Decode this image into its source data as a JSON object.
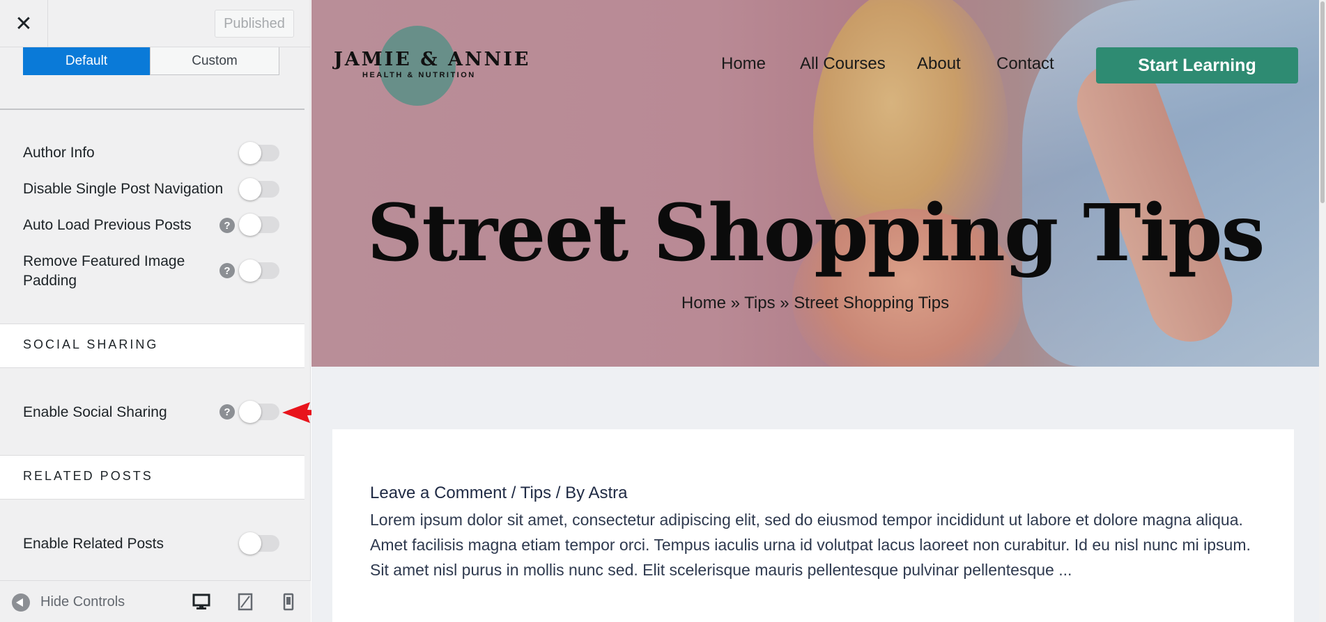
{
  "sidebar": {
    "published_label": "Published",
    "segments": {
      "default": "Default",
      "custom": "Custom"
    },
    "options": [
      {
        "label": "Author Info",
        "help": false,
        "enabled": false
      },
      {
        "label": "Disable Single Post Navigation",
        "help": false,
        "enabled": false
      },
      {
        "label": "Auto Load Previous Posts",
        "help": true,
        "enabled": false
      },
      {
        "label": "Remove Featured Image Padding",
        "label_line1": "Remove Featured Image",
        "label_line2": "Padding",
        "help": true,
        "enabled": false
      }
    ],
    "sections": [
      {
        "title": "SOCIAL SHARING",
        "options": [
          {
            "label": "Enable Social Sharing",
            "help": true,
            "enabled": false
          }
        ]
      },
      {
        "title": "RELATED POSTS",
        "options": [
          {
            "label": "Enable Related Posts",
            "help": false,
            "enabled": false
          }
        ]
      }
    ],
    "help_glyph": "?",
    "footer": {
      "hide_controls_label": "Hide Controls"
    }
  },
  "preview": {
    "logo": {
      "name": "JAMIE & ANNIE",
      "tagline": "HEALTH & NUTRITION"
    },
    "nav": [
      "Home",
      "All Courses",
      "About",
      "Contact"
    ],
    "cta_label": "Start Learning",
    "hero_title": "Street Shopping Tips",
    "breadcrumb": "Home » Tips » Street Shopping Tips",
    "post": {
      "meta": "Leave a Comment / Tips / By Astra",
      "excerpt": "Lorem ipsum dolor sit amet, consectetur adipiscing elit, sed do eiusmod tempor incididunt ut labore et dolore magna aliqua. Amet facilisis magna etiam tempor orci. Tempus iaculis urna id volutpat lacus laoreet non curabitur. Id eu nisl nunc mi ipsum. Sit amet nisl purus in mollis nunc sed. Elit scelerisque mauris pellentesque pulvinar pellentesque ..."
    }
  },
  "colors": {
    "accent_blue": "#0a7ad8",
    "cta_green": "#2e8b72",
    "annotation_red": "#e8141c"
  },
  "icons": [
    "close-icon",
    "help-icon",
    "hide-controls-icon",
    "desktop-icon",
    "tablet-icon",
    "mobile-icon",
    "arrow-annotation"
  ]
}
